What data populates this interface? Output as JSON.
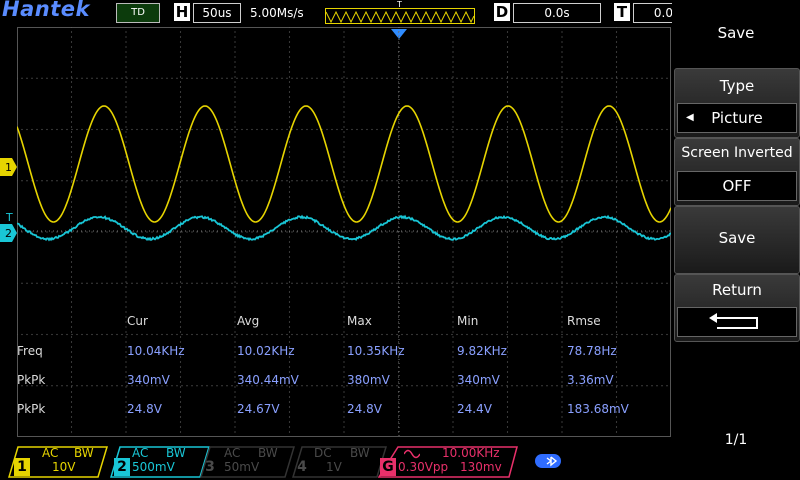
{
  "header": {
    "brand": "Hantek",
    "mode": "TD",
    "timebase_letter": "H",
    "timebase": "50us",
    "sample_rate": "5.00Ms/s",
    "trigger_strip_label": "T",
    "delay_letter": "D",
    "delay": "0.0s",
    "trigger_letter": "T",
    "trigger_value": "0.0"
  },
  "markers": {
    "ch1": "1",
    "ch2": "2",
    "trig_level": "T"
  },
  "measurements": {
    "columns": [
      "Cur",
      "Avg",
      "Max",
      "Min",
      "Rmse"
    ],
    "rows": [
      {
        "label": "Freq",
        "values": [
          "10.04KHz",
          "10.02KHz",
          "10.35KHz",
          "9.82KHz",
          "78.78Hz"
        ]
      },
      {
        "label": "PkPk",
        "values": [
          "340mV",
          "340.44mV",
          "380mV",
          "340mV",
          "3.36mV"
        ]
      },
      {
        "label": "PkPk",
        "values": [
          "24.8V",
          "24.67V",
          "24.8V",
          "24.4V",
          "183.68mV"
        ]
      }
    ]
  },
  "menu": {
    "title": "Save",
    "type_label": "Type",
    "type_value": "Picture",
    "screen_inverted_label": "Screen Inverted",
    "screen_inverted_value": "OFF",
    "save_label": "Save",
    "return_label": "Return",
    "page": "1/1"
  },
  "channels": [
    {
      "num": "1",
      "coupling": "AC",
      "bw": "BW",
      "scale": "10V",
      "color": "#e6d400",
      "active": true
    },
    {
      "num": "2",
      "coupling": "AC",
      "bw": "BW",
      "scale": "500mV",
      "color": "#19c6d6",
      "active": true
    },
    {
      "num": "3",
      "coupling": "AC",
      "bw": "BW",
      "scale": "50mV",
      "color": "#4a4a4a",
      "active": false
    },
    {
      "num": "4",
      "coupling": "DC",
      "bw": "BW",
      "scale": "1V",
      "color": "#4a4a4a",
      "active": false
    }
  ],
  "generator": {
    "num": "G",
    "wave": "sine-icon",
    "freq": "10.00KHz",
    "amp": "0.30Vpp",
    "offset": "130mv",
    "color": "#e8306a"
  },
  "colors": {
    "ch1": "#e6d400",
    "ch2": "#19c6d6",
    "trigger": "#2f8cff",
    "brand": "#5a8cff"
  }
}
